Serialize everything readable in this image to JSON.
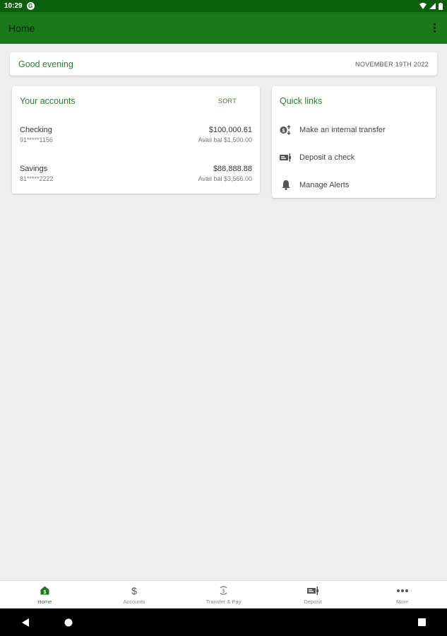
{
  "status_bar": {
    "time": "10:29",
    "app_icon_letter": "G"
  },
  "app_bar": {
    "title": "Home"
  },
  "greeting": {
    "text": "Good evening",
    "date": "NOVEMBER 19TH 2022"
  },
  "accounts": {
    "title": "Your accounts",
    "sort_label": "SORT",
    "items": [
      {
        "name": "Checking",
        "number": "91*****1156",
        "balance": "$100,000.61",
        "available": "Avail bal $1,500.00"
      },
      {
        "name": "Savings",
        "number": "81*****2222",
        "balance": "$88,888.88",
        "available": "Avail bal $3,566.00"
      }
    ]
  },
  "quick_links": {
    "title": "Quick links",
    "items": [
      {
        "label": "Make an internal transfer",
        "icon": "transfer-icon"
      },
      {
        "label": "Deposit a check",
        "icon": "check-deposit-icon"
      },
      {
        "label": "Manage Alerts",
        "icon": "bell-icon"
      }
    ]
  },
  "bottom_nav": {
    "items": [
      {
        "label": "Home",
        "icon": "home-icon",
        "active": true
      },
      {
        "label": "Accounts",
        "icon": "dollar-icon",
        "active": false
      },
      {
        "label": "Transfer & Pay",
        "icon": "transfer-pay-icon",
        "active": false
      },
      {
        "label": "Deposit",
        "icon": "deposit-icon",
        "active": false
      },
      {
        "label": "More",
        "icon": "more-icon",
        "active": false
      }
    ]
  },
  "colors": {
    "primary": "#1a7a1a",
    "status_bar": "#0b5e0b",
    "accent_text": "#2e7d32",
    "background": "#eeeeee"
  }
}
